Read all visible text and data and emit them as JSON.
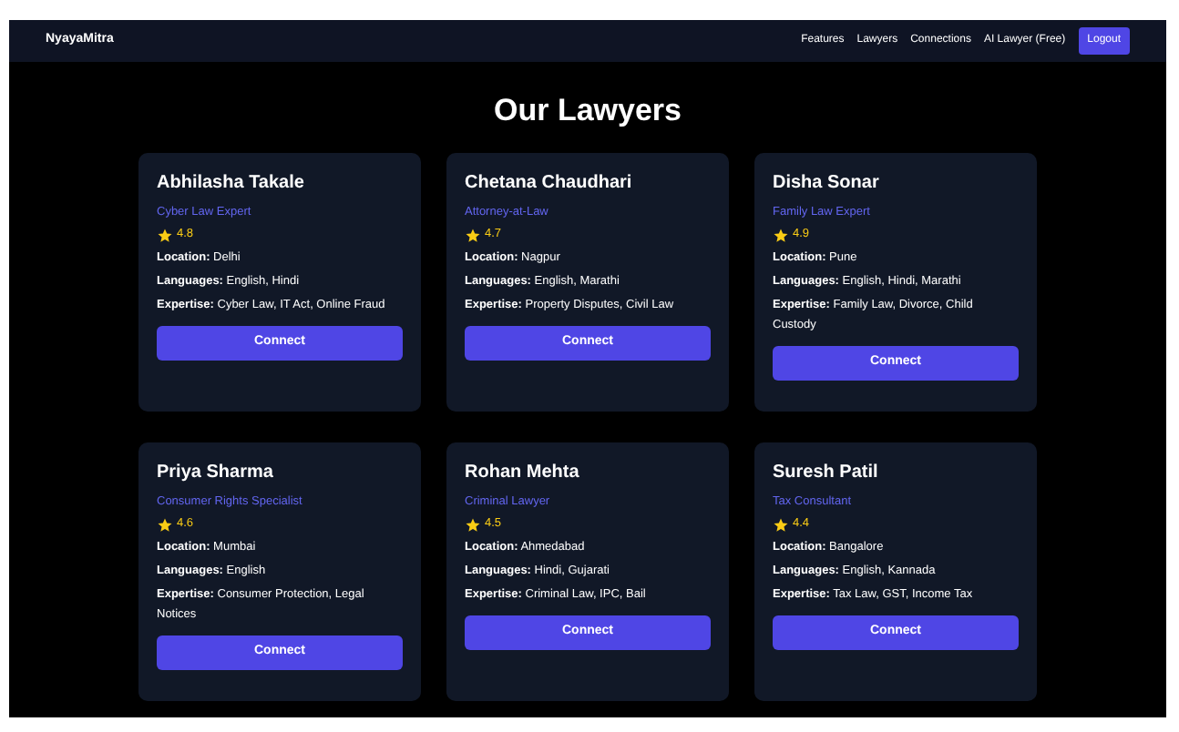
{
  "nav": {
    "brand": "NyayaMitra",
    "links": [
      "Features",
      "Lawyers",
      "Connections",
      "AI Lawyer (Free)"
    ],
    "logout": "Logout"
  },
  "heading": "Our Lawyers",
  "lawyers": [
    {
      "name": "Abhilasha Takale",
      "title": "Cyber Law Expert",
      "rating": "4.8",
      "details": [
        "**Location:** Delhi",
        "**Languages:** English, Hindi",
        "**Expertise:** Cyber Law, IT Act, Online Fraud"
      ],
      "button": "Connect"
    },
    {
      "name": "Chetana Chaudhari",
      "title": "Attorney-at-Law",
      "rating": "4.7",
      "details": [
        "**Location:** Nagpur",
        "**Languages:** English, Marathi",
        "**Expertise:** Property Disputes, Civil Law"
      ],
      "button": "Connect"
    },
    {
      "name": "Disha Sonar",
      "title": "Family Law Expert",
      "rating": "4.9",
      "details": [
        "**Location:** Pune",
        "**Languages:** English, Hindi, Marathi",
        "**Expertise:** Family Law, Divorce, Child Custody"
      ],
      "button": "Connect"
    },
    {
      "name": "Priya Sharma",
      "title": "Consumer Rights Specialist",
      "rating": "4.6",
      "details": [
        "**Location:** Mumbai",
        "**Languages:** English",
        "**Expertise:** Consumer Protection, Legal Notices"
      ],
      "button": "Connect"
    },
    {
      "name": "Rohan Mehta",
      "title": "Criminal Lawyer",
      "rating": "4.5",
      "details": [
        "**Location:** Ahmedabad",
        "**Languages:** Hindi, Gujarati",
        "**Expertise:** Criminal Law, IPC, Bail"
      ],
      "button": "Connect"
    },
    {
      "name": "Suresh Patil",
      "title": "Tax Consultant",
      "rating": "4.4",
      "details": [
        "**Location:** Bangalore",
        "**Languages:** English, Kannada",
        "**Expertise:** Tax Law, GST, Income Tax"
      ],
      "button": "Connect"
    }
  ]
}
